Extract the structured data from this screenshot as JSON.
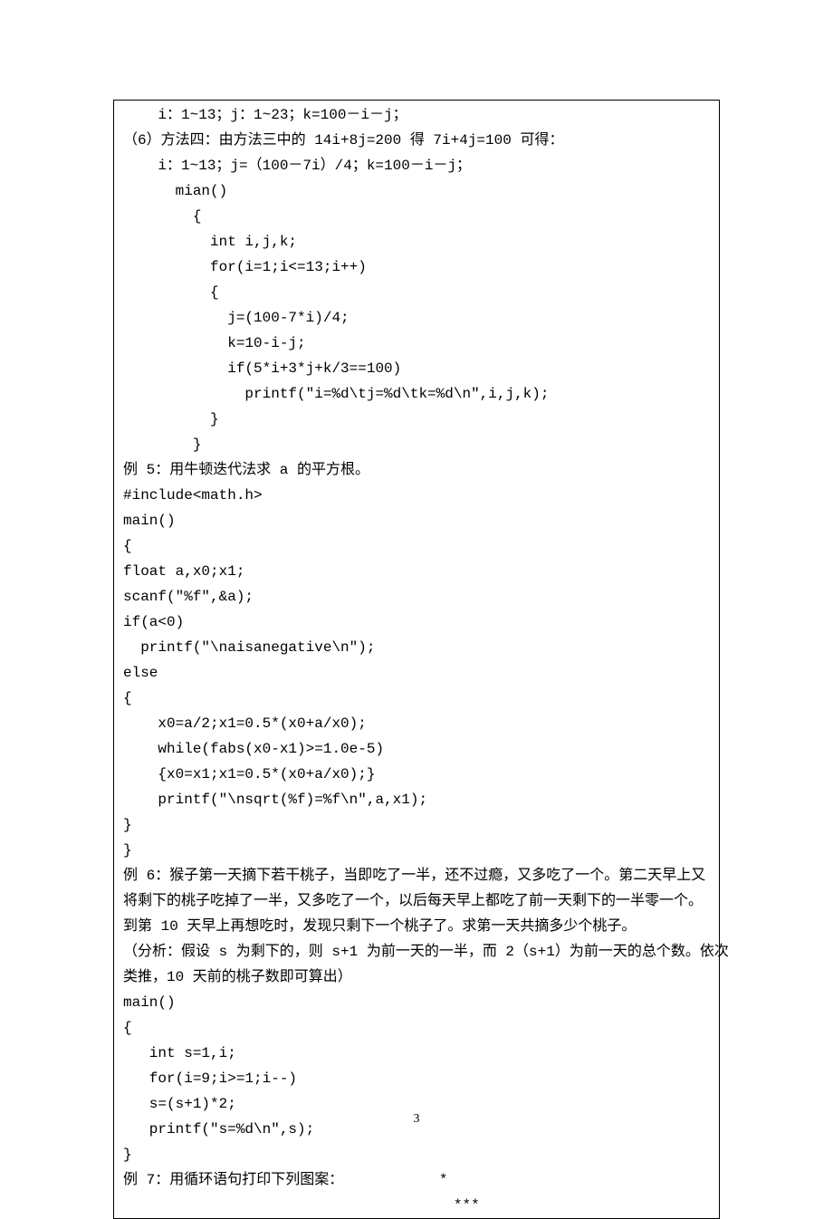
{
  "lines": [
    "    i：1~13；j：1~23；k=100－i－j；",
    "（6）方法四：由方法三中的 14i+8j=200 得 7i+4j=100 可得：",
    "    i：1~13；j=（100－7i）/4；k=100－i－j；",
    "      mian()",
    "        {",
    "          int i,j,k;",
    "          for(i=1;i<=13;i++)",
    "          {",
    "            j=(100-7*i)/4;",
    "            k=10-i-j;",
    "            if(5*i+3*j+k/3==100)",
    "              printf(\"i=%d\\tj=%d\\tk=%d\\n\",i,j,k);",
    "          }",
    "        }",
    "例 5：用牛顿迭代法求 a 的平方根。",
    "#include<math.h>",
    "main()",
    "{",
    "float a,x0;x1;",
    "scanf(\"%f\",&a);",
    "if(a<0)",
    "  printf(\"\\naisanegative\\n\");",
    "else",
    "{",
    "    x0=a/2;x1=0.5*(x0+a/x0);",
    "    while(fabs(x0-x1)>=1.0e-5)",
    "    {x0=x1;x1=0.5*(x0+a/x0);}",
    "    printf(\"\\nsqrt(%f)=%f\\n\",a,x1);",
    "}",
    "}",
    "例 6：猴子第一天摘下若干桃子，当即吃了一半，还不过瘾，又多吃了一个。第二天早上又",
    "将剩下的桃子吃掉了一半，又多吃了一个，以后每天早上都吃了前一天剩下的一半零一个。",
    "到第 10 天早上再想吃时，发现只剩下一个桃子了。求第一天共摘多少个桃子。",
    "（分析：假设 s 为剩下的，则 s+1 为前一天的一半，而 2（s+1）为前一天的总个数。依次",
    "类推，10 天前的桃子数即可算出）",
    "main()",
    "{",
    "   int s=1,i;",
    "   for(i=9;i>=1;i--)",
    "   s=(s+1)*2;",
    "   printf(\"s=%d\\n\",s);",
    "}",
    "例 7：用循环语句打印下列图案：           *",
    "                                      ***"
  ],
  "page_number": "3"
}
